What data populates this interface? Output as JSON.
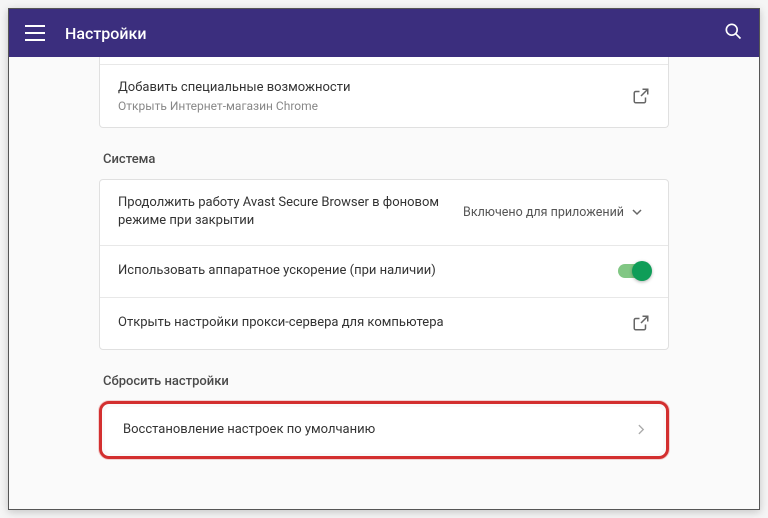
{
  "header": {
    "title": "Настройки"
  },
  "accessibility": {
    "add_title": "Добавить специальные возможности",
    "add_subtitle": "Открыть Интернет-магазин Chrome"
  },
  "sections": {
    "system": "Система",
    "reset": "Сбросить настройки"
  },
  "system": {
    "background_label": "Продолжить работу Avast Secure Browser в фоновом режиме при закрытии",
    "background_value": "Включено для приложений",
    "hw_accel_label": "Использовать аппаратное ускорение (при наличии)",
    "proxy_label": "Открыть настройки прокси-сервера для компьютера"
  },
  "reset": {
    "restore_label": "Восстановление настроек по умолчанию"
  }
}
